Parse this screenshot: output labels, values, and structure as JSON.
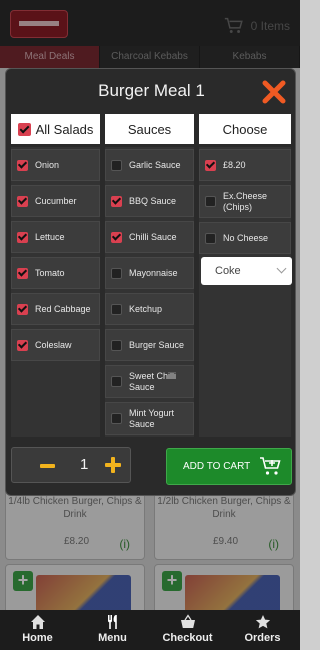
{
  "header": {
    "cart_count": "0 Items"
  },
  "category_tabs": [
    "Meal Deals",
    "Charcoal Kebabs",
    "Kebabs"
  ],
  "bg_cards": [
    {
      "name": "1/4lb Chicken Burger, Chips & Drink",
      "price": "£8.20",
      "info": "(i)"
    },
    {
      "name": "1/2lb Chicken Burger, Chips & Drink",
      "price": "£9.40",
      "info": "(i)"
    },
    {
      "plus": "+"
    },
    {
      "plus": "+"
    }
  ],
  "modal": {
    "title": "Burger Meal 1",
    "columns": {
      "salads": {
        "header": "All Salads",
        "header_checked": true
      },
      "sauces": {
        "header": "Sauces"
      },
      "choose": {
        "header": "Choose"
      }
    },
    "salads": [
      {
        "label": "Onion",
        "checked": true
      },
      {
        "label": "Cucumber",
        "checked": true
      },
      {
        "label": "Lettuce",
        "checked": true
      },
      {
        "label": "Tomato",
        "checked": true
      },
      {
        "label": "Red Cabbage",
        "checked": true
      },
      {
        "label": "Coleslaw",
        "checked": true
      }
    ],
    "sauces": [
      {
        "label": "Garlic Sauce",
        "checked": false
      },
      {
        "label": "BBQ Sauce",
        "checked": true
      },
      {
        "label": "Chilli Sauce",
        "checked": true
      },
      {
        "label": "Mayonnaise",
        "checked": false
      },
      {
        "label": "Ketchup",
        "checked": false
      },
      {
        "label": "Burger Sauce",
        "checked": false
      },
      {
        "label": "Sweet Chilli Sauce",
        "checked": false
      },
      {
        "label": "Mint Yogurt Sauce",
        "checked": false
      }
    ],
    "choose": [
      {
        "label": "£8.20",
        "checked": true
      },
      {
        "label": "Ex.Cheese (Chips)",
        "checked": false
      },
      {
        "label": "No Cheese",
        "checked": false
      }
    ],
    "drink_select": {
      "selected": "Coke"
    },
    "quantity": "1",
    "add_to_cart_label": "ADD TO CART"
  },
  "bottom_nav": [
    {
      "label": "Home",
      "icon": "home-icon"
    },
    {
      "label": "Menu",
      "icon": "cutlery-icon"
    },
    {
      "label": "Checkout",
      "icon": "basket-icon"
    },
    {
      "label": "Orders",
      "icon": "star-icon"
    }
  ],
  "colors": {
    "accent_red": "#d94050",
    "cart_green": "#1d8a2a",
    "qty_yellow": "#f2b31d",
    "close_orange": "#f05a23"
  }
}
